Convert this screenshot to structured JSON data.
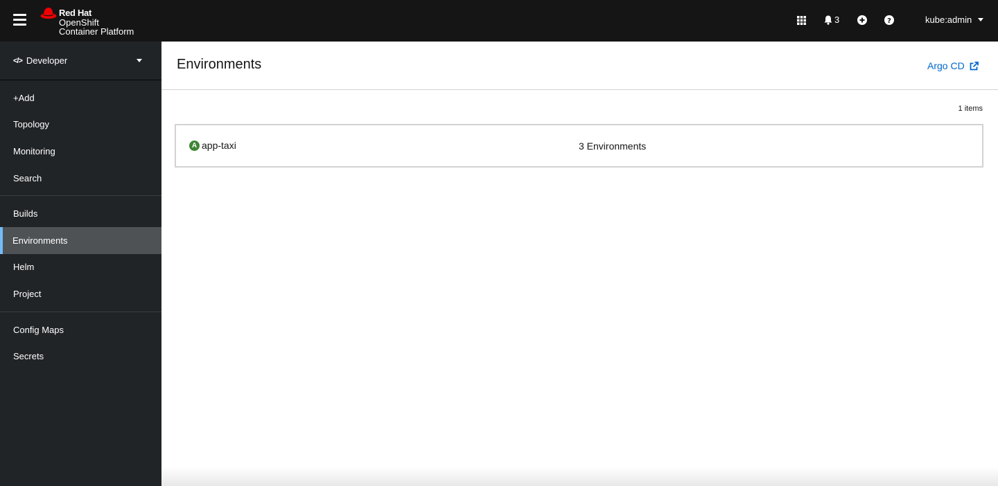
{
  "masthead": {
    "brand": {
      "line1": "Red Hat",
      "line2": "OpenShift",
      "line3": "Container Platform"
    },
    "notifications_count": "3",
    "user": "kube:admin",
    "icons": {
      "menu": "hamburger-icon",
      "apps": "grid-icon",
      "notifications": "bell-icon",
      "add": "plus-circle-icon",
      "help": "question-circle-icon",
      "user_menu": "caret-down-icon"
    }
  },
  "sidebar": {
    "perspective": "Developer",
    "groups": [
      [
        {
          "label": "+Add"
        },
        {
          "label": "Topology"
        },
        {
          "label": "Monitoring"
        },
        {
          "label": "Search"
        }
      ],
      [
        {
          "label": "Builds"
        },
        {
          "label": "Environments",
          "active": true
        },
        {
          "label": "Helm"
        },
        {
          "label": "Project"
        }
      ],
      [
        {
          "label": "Config Maps"
        },
        {
          "label": "Secrets"
        }
      ]
    ]
  },
  "main": {
    "title": "Environments",
    "external_link": "Argo CD",
    "items_count": "1 items",
    "rows": [
      {
        "badge": "A",
        "name": "app-taxi",
        "environments": "3 Environments"
      }
    ]
  },
  "colors": {
    "masthead_bg": "#151515",
    "sidebar_bg": "#212427",
    "active_item_bg": "#4f5255",
    "active_indicator": "#73bcf7",
    "link": "#0066cc",
    "badge_green": "#3e8635",
    "brand_red": "#ee0000"
  }
}
